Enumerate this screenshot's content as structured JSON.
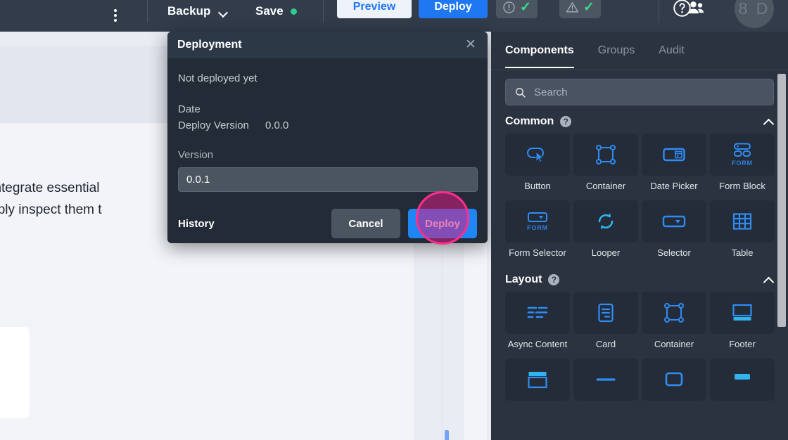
{
  "topbar": {
    "kebab_icon": "more-vertical-icon",
    "backup_label": "Backup",
    "backup_chevron_icon": "chevron-down-icon",
    "save_label": "Save",
    "save_status_color": "#2ecc8f",
    "preview_label": "Preview",
    "deploy_label": "Deploy",
    "error_chip": {
      "icon": "error-circle-icon",
      "status_icon": "check-icon"
    },
    "warning_chip": {
      "icon": "warning-triangle-icon",
      "status_icon": "check-icon"
    },
    "help_icon": "help-circle-icon",
    "users_icon": "users-icon",
    "avatar_text": "8 D"
  },
  "canvas": {
    "text_line_1": "rs to integrate essential",
    "text_line_2": "or simply inspect them t"
  },
  "dialog": {
    "title": "Deployment",
    "close_icon": "close-icon",
    "status": "Not deployed yet",
    "date_label": "Date",
    "date_value": "",
    "deploy_version_label": "Deploy Version",
    "deploy_version_value": "0.0.0",
    "version_label": "Version",
    "version_value": "0.0.1",
    "version_placeholder": "Version",
    "history_label": "History",
    "cancel_label": "Cancel",
    "deploy_label": "Deploy",
    "accent_blue": "#1f87f5",
    "highlight_color": "#ff2d8e"
  },
  "panel": {
    "tabs": [
      {
        "label": "Components",
        "active": true
      },
      {
        "label": "Groups",
        "active": false
      },
      {
        "label": "Audit",
        "active": false
      }
    ],
    "search": {
      "placeholder": "Search",
      "value": "",
      "icon": "search-icon"
    },
    "sections": [
      {
        "title": "Common",
        "help_icon": "help-badge-icon",
        "collapse_icon": "chevron-up-icon",
        "help_badge": "?",
        "items": [
          {
            "label": "Button",
            "icon": "button-icon",
            "tag": ""
          },
          {
            "label": "Container",
            "icon": "container-icon",
            "tag": ""
          },
          {
            "label": "Date Picker",
            "icon": "date-picker-icon",
            "tag": ""
          },
          {
            "label": "Form Block",
            "icon": "form-block-icon",
            "tag": "FORM"
          },
          {
            "label": "Form Selector",
            "icon": "form-selector-icon",
            "tag": "FORM"
          },
          {
            "label": "Looper",
            "icon": "looper-icon",
            "tag": ""
          },
          {
            "label": "Selector",
            "icon": "selector-icon",
            "tag": ""
          },
          {
            "label": "Table",
            "icon": "table-icon",
            "tag": ""
          }
        ]
      },
      {
        "title": "Layout",
        "help_icon": "help-badge-icon",
        "collapse_icon": "chevron-up-icon",
        "help_badge": "?",
        "items": [
          {
            "label": "Async Content",
            "icon": "async-content-icon",
            "tag": ""
          },
          {
            "label": "Card",
            "icon": "card-icon",
            "tag": ""
          },
          {
            "label": "Container",
            "icon": "container-icon",
            "tag": ""
          },
          {
            "label": "Footer",
            "icon": "footer-icon",
            "tag": ""
          },
          {
            "label": "",
            "icon": "header-icon",
            "tag": ""
          },
          {
            "label": "",
            "icon": "divider-icon",
            "tag": ""
          },
          {
            "label": "",
            "icon": "modal-icon",
            "tag": ""
          },
          {
            "label": "",
            "icon": "panel-icon",
            "tag": ""
          }
        ]
      }
    ]
  }
}
